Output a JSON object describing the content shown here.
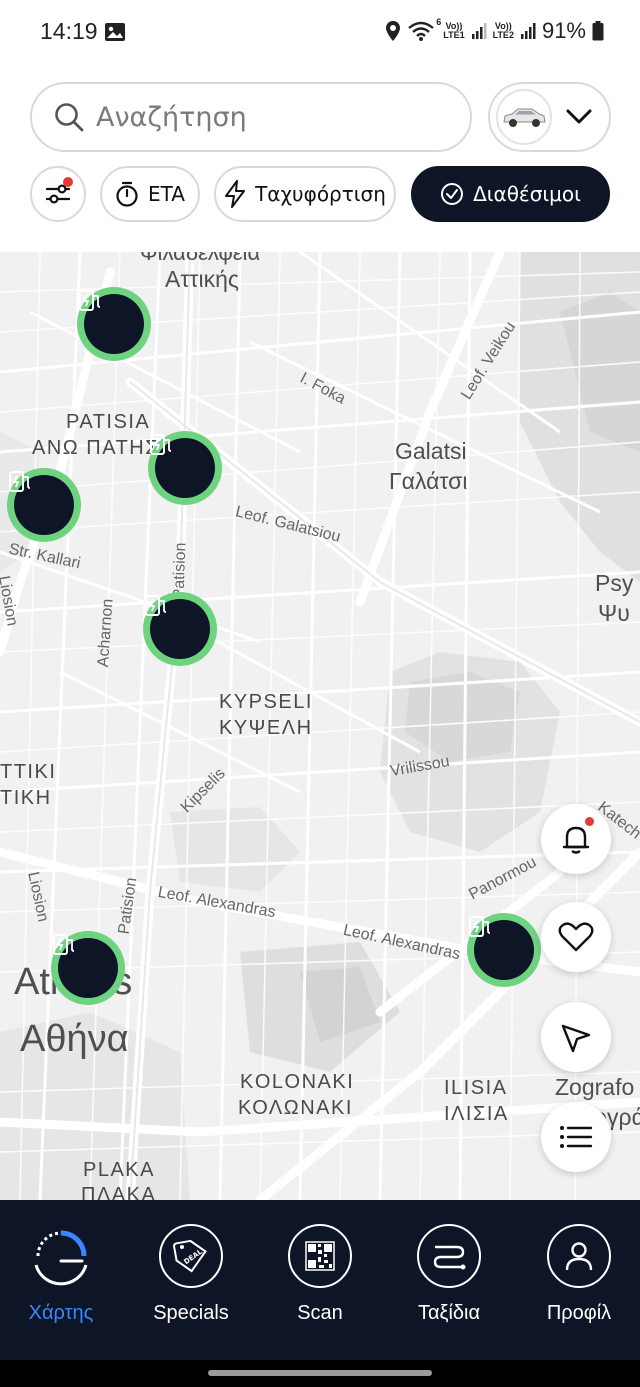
{
  "status_bar": {
    "time": "14:19",
    "battery": "91%",
    "sim1": "LTE1",
    "sim2": "LTE2",
    "volte": "Vo))",
    "wifi_badge": "6"
  },
  "header": {
    "search": {
      "placeholder": "Αναζήτηση"
    }
  },
  "filters": {
    "eta_label": "ETA",
    "fast_charge_label": "Ταχυφόρτιση",
    "available_label": "Διαθέσιμοι"
  },
  "map": {
    "labels": {
      "filadelfeia": "Φιλαδέλφεια",
      "attikis": "Αττικής",
      "patisia": "PATISIA",
      "ano_patisia": "ΑΝΩ ΠΑΤΗΣΙΑ",
      "galatsi_en": "Galatsi",
      "galatsi_gr": "Γαλάτσι",
      "kypseli_en": "KYPSELI",
      "kypseli_gr": "ΚΥΨΕΛΗ",
      "attiki_en": "TTIKI",
      "attiki_gr": "ΤΙΚΗ",
      "athens_en": "Athens",
      "athens_gr": "Αθήνα",
      "kolonaki_en": "KOLONAKI",
      "kolonaki_gr": "ΚΟΛΩΝΑΚΙ",
      "ilisia_en": "ILISIA",
      "ilisia_gr": "ΙΛΙΣΙΑ",
      "plaka_en": "PLAKA",
      "plaka_gr": "ΠΛΑΚΑ",
      "psychiko_en": "Psy",
      "psychiko_gr": "Ψυ",
      "zografou_en": "Zografo",
      "zografou_gr": "Ζωγράφ",
      "i_foka": "I. Foka",
      "leof_veikou": "Leof. Veikou",
      "leof_galatsiou": "Leof. Galatsiou",
      "str_kallari": "Str. Kallari",
      "liosion": "Liosion",
      "acharnon": "Acharnon",
      "patision": "Patision",
      "kipselis": "Kipselis",
      "vrilissou": "Vrilissou",
      "leof_alexandras": "Leof. Alexandras",
      "panormou": "Panormou",
      "katech": "Katech"
    }
  },
  "bottom_nav": {
    "items": [
      {
        "label": "Χάρτης",
        "icon": "map-gauge-icon",
        "active": true
      },
      {
        "label": "Specials",
        "icon": "deal-tag-icon"
      },
      {
        "label": "Scan",
        "icon": "qr-code-icon"
      },
      {
        "label": "Ταξίδια",
        "icon": "route-icon"
      },
      {
        "label": "Προφίλ",
        "icon": "user-icon"
      }
    ]
  },
  "colors": {
    "navy": "#0d1526",
    "pin_ring": "#6dd37f",
    "accent_blue": "#3a86ff",
    "notification_red": "#e53935"
  }
}
